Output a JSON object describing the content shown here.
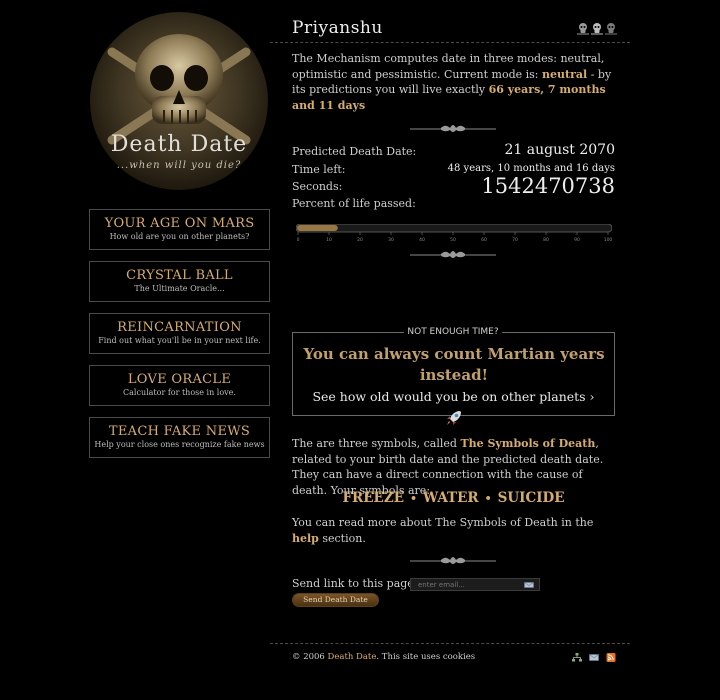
{
  "logo": {
    "title": "Death Date",
    "tagline": "...when will you die?"
  },
  "sidebar": {
    "items": [
      {
        "title": "YOUR AGE ON MARS",
        "subtitle": "How old are you on other planets?"
      },
      {
        "title": "CRYSTAL BALL",
        "subtitle": "The Ultimate Oracle..."
      },
      {
        "title": "REINCARNATION",
        "subtitle": "Find out what you'll be in your next life."
      },
      {
        "title": "LOVE ORACLE",
        "subtitle": "Calculator for those in love."
      },
      {
        "title": "TEACH FAKE NEWS",
        "subtitle": "Help your close ones recognize fake news"
      }
    ]
  },
  "header": {
    "name": "Priyanshu",
    "icons": [
      "skull-icon",
      "skull-icon",
      "skull-icon"
    ]
  },
  "intro": {
    "text1": "The Mechanism computes date in three modes: neutral, optimistic and pessimistic. Current mode is: ",
    "mode": "neutral",
    "text2": " - by its predictions you will live exactly ",
    "lifespan": "66 years, 7 months and 11 days"
  },
  "stats": {
    "predicted_label": "Predicted Death Date:",
    "predicted_value": "21 august 2070",
    "timeleft_label": "Time left:",
    "timeleft_value": "48 years, 10 months and 16 days",
    "seconds_label": "Seconds:",
    "seconds_value": "1542470738",
    "percent_label": "Percent of life passed:",
    "percent_fraction": 0.13,
    "scale_ticks": [
      "0",
      "10",
      "20",
      "30",
      "40",
      "50",
      "60",
      "70",
      "80",
      "90",
      "100"
    ]
  },
  "promo": {
    "title": "NOT ENOUGH TIME?",
    "headline": "You can always count Martian years instead!",
    "link": "See how old would you be on other planets ›"
  },
  "symbols_text": {
    "text1": "The are three symbols, called ",
    "name": "The Symbols of Death",
    "text2": ", related to your birth date and the predicted death date. They can have a direct connection with the cause of death. Your symbols are:"
  },
  "symbols": [
    "FREEZE",
    "WATER",
    "SUICIDE"
  ],
  "help_text": {
    "text1": "You can read more about The Symbols of Death in the ",
    "link": "help",
    "text2": " section."
  },
  "send": {
    "label": "Send link to this page:",
    "email_placeholder": "enter email...",
    "button": "Send Death Date"
  },
  "footer": {
    "copyright": "© 2006 ",
    "site_link": "Death Date",
    "cookies": ". This site uses cookies",
    "icons": [
      "sitemap-icon",
      "mail-icon",
      "rss-icon"
    ]
  },
  "colors": {
    "accent": "#d7ad6e",
    "background": "#000000",
    "text": "#cfcfcf",
    "border": "#4a4a4a"
  }
}
